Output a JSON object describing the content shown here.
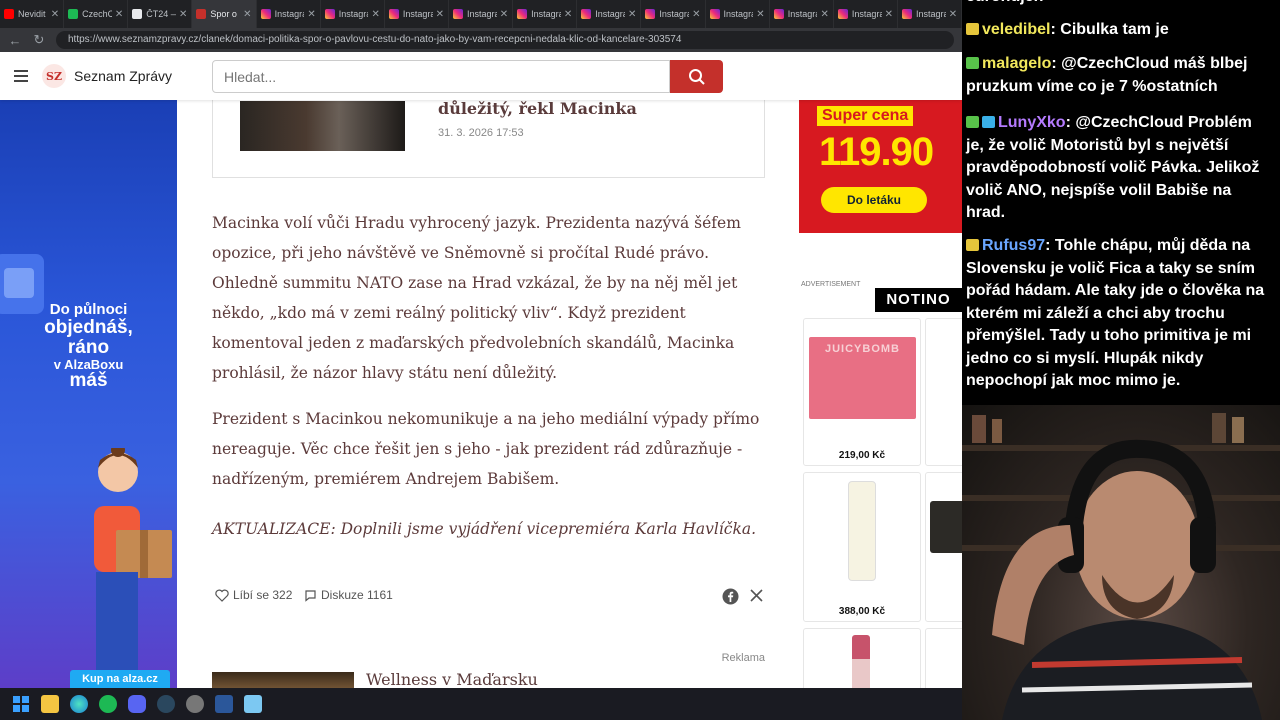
{
  "browser": {
    "tabs": [
      {
        "title": "Nevidit",
        "color": "#ff0000",
        "active": false
      },
      {
        "title": "CzechC",
        "color": "#1db954",
        "active": false
      },
      {
        "title": "ČT24 —",
        "color": "#e8eaed",
        "active": false
      },
      {
        "title": "Spor o",
        "color": "#c4302b",
        "active": true
      },
      {
        "title": "Instagra",
        "color": "ig",
        "active": false
      },
      {
        "title": "Instagra",
        "color": "ig",
        "active": false
      },
      {
        "title": "Instagra",
        "color": "ig",
        "active": false
      },
      {
        "title": "Instagra",
        "color": "ig",
        "active": false
      },
      {
        "title": "Instagra",
        "color": "ig",
        "active": false
      },
      {
        "title": "Instagra",
        "color": "ig",
        "active": false
      },
      {
        "title": "Instagra",
        "color": "ig",
        "active": false
      },
      {
        "title": "Instagra",
        "color": "ig",
        "active": false
      },
      {
        "title": "Instagra",
        "color": "ig",
        "active": false
      },
      {
        "title": "Instagra",
        "color": "ig",
        "active": false
      },
      {
        "title": "Instagra",
        "color": "ig",
        "active": false
      }
    ],
    "url": "https://www.seznamzpravy.cz/clanek/domaci-politika-spor-o-pavlovu-cestu-do-nato-jako-by-vam-recepcni-nedala-klic-od-kancelare-303574"
  },
  "site": {
    "logo": "SZ",
    "brand": "Seznam Zprávy",
    "search_placeholder": "Hledat..."
  },
  "related": {
    "title": "důležitý, řekl Macinka",
    "date": "31. 3. 2026 17:53"
  },
  "article": {
    "paragraphs": [
      "Macinka volí vůči Hradu vyhrocený jazyk. Prezidenta nazývá šéfem opozice, při jeho návštěvě ve Sněmovně si pročítal Rudé právo. Ohledně summitu NATO zase na Hrad vzkázal, že by na něj měl jet někdo, „kdo má v zemi reálný politický vliv“. Když prezident komentoval jeden z maďarských předvolebních skandálů, Macinka prohlásil, že názor hlavy státu není důležitý.",
      "Prezident s Macinkou nekomunikuje a na jeho mediální výpady přímo nereaguje. Věc chce řešit jen s jeho - jak prezident rád zdůrazňuje - nadřízeným, premiérem Andrejem Babišem."
    ],
    "update": "AKTUALIZACE: Doplnili jsme vyjádření vicepremiéra Karla Havlíčka.",
    "likes": "Líbí se 322",
    "discussion": "Diskuze 1161",
    "ad_label": "Reklama",
    "next_title": "Wellness v Maďarsku"
  },
  "ads": {
    "left": {
      "line1": "Do půlnoci",
      "line2": "objednáš,",
      "line3": "ráno",
      "line4": "v AlzaBoxu",
      "line5": "máš",
      "cta": "Kup na alza.cz"
    },
    "lidl": {
      "badge": "Super cena",
      "price": "119.90",
      "cta": "Do letáku"
    },
    "advertisement": "ADVERTISEMENT",
    "notino": "NOTINO",
    "products": [
      {
        "label": "JUICYBOMB",
        "price": "219,00 Kč"
      },
      {
        "price": "388,00 Kč"
      }
    ]
  },
  "chat": {
    "top_fragment": "euronujen",
    "messages": [
      {
        "user": "veledibel",
        "user_color": "#f2e85c",
        "badge_color": "#e5c53b",
        "text": "Cibulka tam je"
      },
      {
        "user": "malagelo",
        "user_color": "#f2e85c",
        "badge_color": "#58c24a",
        "text": "@CzechCloud máš blbej pruzkum víme co je 7 %ostatních"
      },
      {
        "user": "LunyXko",
        "user_color": "#b57bff",
        "badge_color": "#58c24a",
        "badge2_color": "#3ab0e8",
        "text": "@CzechCloud Problém je, že volič Motoristů byl s největší pravděpodobností volič Pávka. Jelikož volič ANO, nejspíše volil Babiše na hrad."
      },
      {
        "user": "Rufus97",
        "user_color": "#6aa6ff",
        "badge_color": "#e5c53b",
        "text": "Tohle chápu, můj děda na Slovensku je volič Fica a taky se sním pořád hádam. Ale taky jde o člověka na kterém mi záleží a chci aby trochu přemýšlel. Tady u toho primitiva je mi jedno co si myslí. Hlupák nikdy nepochopí jak moc mimo je."
      }
    ]
  }
}
